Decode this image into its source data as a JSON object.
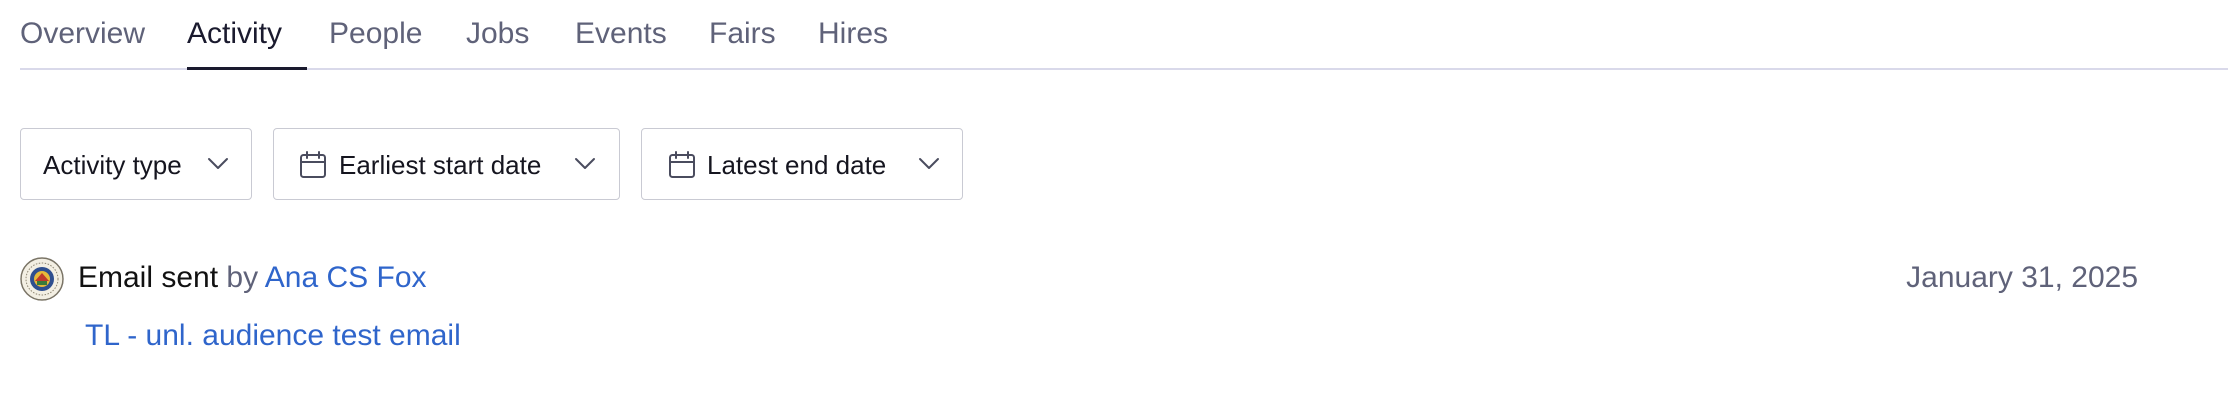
{
  "tabs": [
    {
      "label": "Overview",
      "active": false
    },
    {
      "label": "Activity",
      "active": true
    },
    {
      "label": "People",
      "active": false
    },
    {
      "label": "Jobs",
      "active": false
    },
    {
      "label": "Events",
      "active": false
    },
    {
      "label": "Fairs",
      "active": false
    },
    {
      "label": "Hires",
      "active": false
    }
  ],
  "filters": {
    "activity_type": {
      "label": "Activity type",
      "icon": "chevron-down-icon"
    },
    "earliest_start_date": {
      "label": "Earliest start date",
      "icon": "calendar-icon"
    },
    "latest_end_date": {
      "label": "Latest end date",
      "icon": "calendar-icon"
    }
  },
  "activity": {
    "items": [
      {
        "avatar_icon": "seal-avatar-icon",
        "action": "Email sent",
        "by_text": "by",
        "actor": "Ana CS Fox",
        "date": "January 31, 2025",
        "subject": "TL - unl. audience test email"
      }
    ]
  },
  "colors": {
    "text_primary": "#111111",
    "text_muted": "#5f6279",
    "link": "#2f65cb",
    "border": "#c9cad3",
    "tab_divider": "#d9d9ea"
  }
}
